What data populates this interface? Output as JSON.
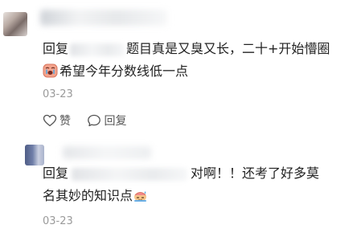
{
  "comments": [
    {
      "reply_prefix": "回复",
      "line1_text": "题目真是又臭又长，二十+开始懵圈",
      "line2_text": "希望今年分数线低一点",
      "time": "03-23",
      "like_label": "赞",
      "reply_label": "回复",
      "emoji_icon": "crying-face-emoji"
    },
    {
      "reply_prefix": "回复",
      "line1_text": "对啊！！还考了好多莫",
      "line2_text": "名其妙的知识点",
      "time": "03-23",
      "emoji_icon": "sweat-smile-emoji"
    }
  ]
}
